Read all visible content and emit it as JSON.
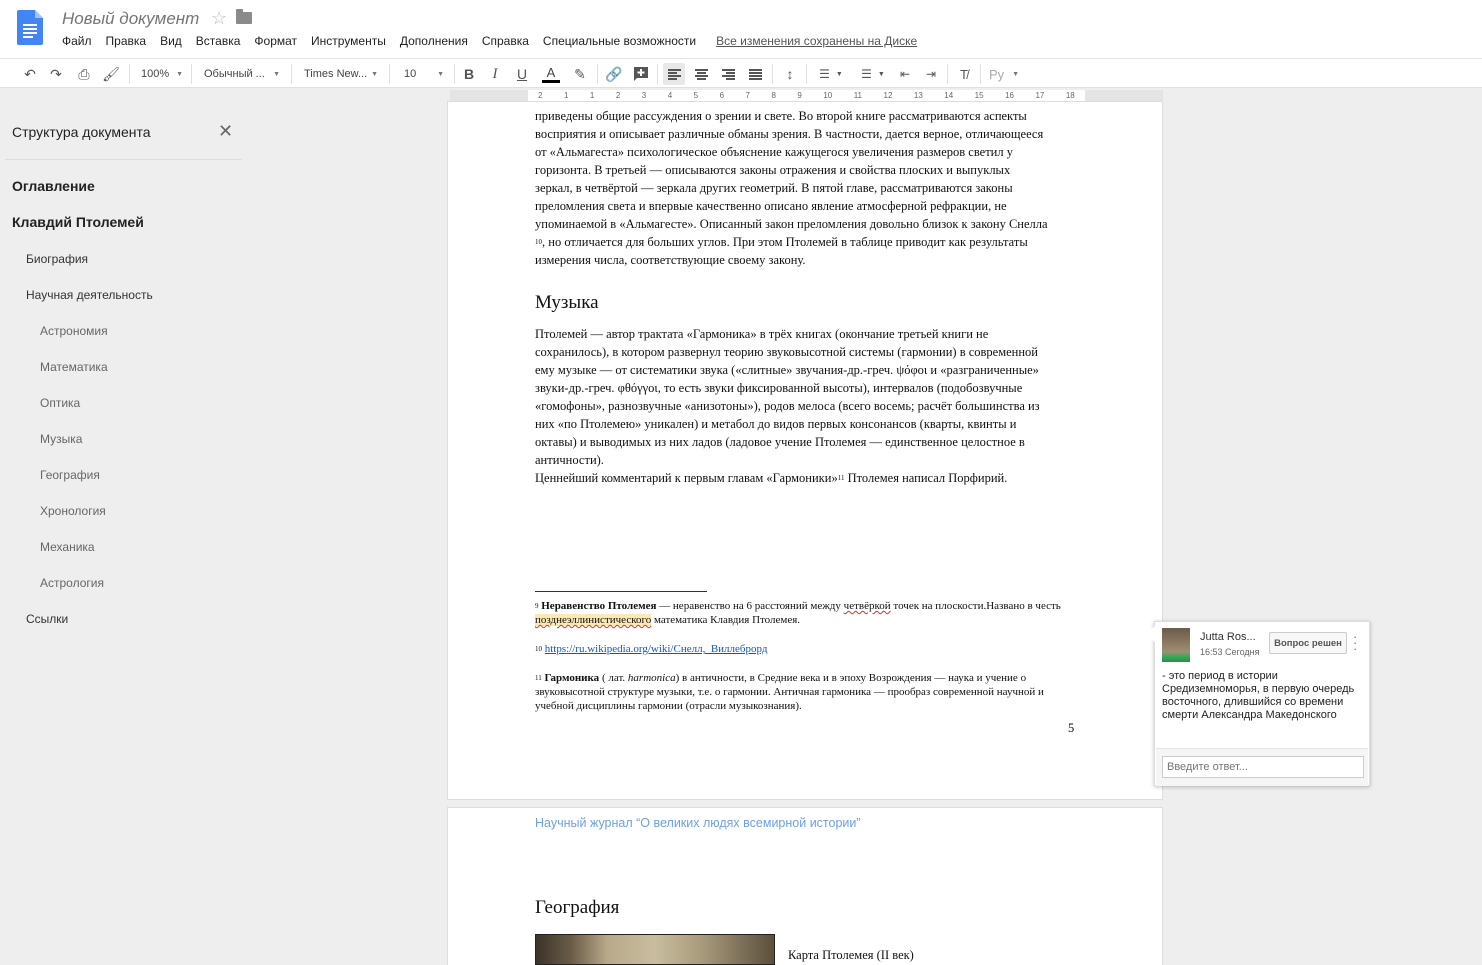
{
  "header": {
    "title": "Новый документ",
    "menu": [
      "Файл",
      "Правка",
      "Вид",
      "Вставка",
      "Формат",
      "Инструменты",
      "Дополнения",
      "Справка",
      "Специальные возможности"
    ],
    "saved_status": "Все изменения сохранены на Диске"
  },
  "toolbar": {
    "zoom": "100%",
    "style": "Обычный ...",
    "font": "Times New...",
    "size": "10",
    "text_color": "A",
    "input_tools": "Ру"
  },
  "ruler": {
    "ticks": [
      "2",
      "1",
      "1",
      "2",
      "3",
      "4",
      "5",
      "6",
      "7",
      "8",
      "9",
      "10",
      "11",
      "12",
      "13",
      "14",
      "15",
      "16",
      "17",
      "18"
    ]
  },
  "outline": {
    "title": "Структура документа",
    "items": [
      {
        "label": "Оглавление",
        "level": 1
      },
      {
        "label": "Клавдий Птолемей",
        "level": 1
      },
      {
        "label": "Биография",
        "level": 2
      },
      {
        "label": "Научная деятельность",
        "level": 2
      },
      {
        "label": "Астрономия",
        "level": 3
      },
      {
        "label": "Математика",
        "level": 3
      },
      {
        "label": "Оптика",
        "level": 3
      },
      {
        "label": "Музыка",
        "level": 3
      },
      {
        "label": "География",
        "level": 3
      },
      {
        "label": "Хронология",
        "level": 3
      },
      {
        "label": "Механика",
        "level": 3
      },
      {
        "label": "Астрология",
        "level": 3
      },
      {
        "label": "Ссылки",
        "level": 2
      }
    ]
  },
  "page1": {
    "top_paragraph_lines": [
      "приведены общие рассуждения о зрении и свете. Во второй книге рассматриваются аспекты",
      "восприятия и описывает различные обманы зрения. В частности, дается верное, отличающееся",
      "от «Альмагеста» психологическое объяснение кажущегося увеличения размеров светил у",
      "горизонта. В третьей — описываются законы отражения и свойства плоских и выпуклых",
      "зеркал, в четвёртой — зеркала других геометрий. В пятой главе, рассматриваются законы",
      "преломления света и впервые качественно описано явление атмосферной рефракции, не",
      "упоминаемой в «Альмагесте». Описанный закон преломления довольно близок к закону Снелла"
    ],
    "top_paragraph_sup": "10",
    "top_paragraph_tail": ", но отличается для больших углов. При этом Птолемей в таблице приводит как результаты",
    "top_paragraph_last": "измерения числа, соответствующие своему закону.",
    "music_heading": "Музыка",
    "music_lines": [
      "Птолемей — автор трактата «Гармоника» в трёх книгах (окончание третьей книги не",
      "сохранилось), в котором развернул теорию звуковысотной системы (гармонии) в современной",
      "ему музыке — от систематики звука («слитные» звучания-др.-греч. ψόφοι и «разграниченные»",
      "звуки-др.-греч. φθόγγοι, то есть звуки фиксированной высоты), интервалов (подобозвучные",
      "«гомофоны», разнозвучные «анизотоны»), родов мелоса (всего восемь; расчёт большинства из",
      "них «по Птолемею» уникален) и метабол до видов первых консонансов (кварты, квинты и",
      "октавы) и выводимых из них ладов (ладовое учение Птолемея — единственное целостное в",
      "античности)."
    ],
    "comment_line_a": "Ценнейший комментарий к первым главам «Гармоники»",
    "comment_line_sup": "11",
    "comment_line_b": " Птолемея написал Порфирий.",
    "fn9_num": "9",
    "fn9_bold": "Неравенство Птолемея",
    "fn9_text_a": " — неравенство на 6 расстояний между ",
    "fn9_err": "четвёркой",
    "fn9_text_b": " точек на плоскости.Названо в честь ",
    "fn9_hl": "позднеэллинистического",
    "fn9_text_c": " математика Клавдия Птолемея.",
    "fn10_num": "10",
    "fn10_link": "https://ru.wikipedia.org/wiki/Снелл,_Виллеброрд",
    "fn11_num": "11",
    "fn11_bold": "Гармоника",
    "fn11_text_a": " ( лат. ",
    "fn11_italic": "harmonica",
    "fn11_text_b": ") в античности, в Средние века и в эпоху Возрождения — наука и учение о звуковысотной структуре музыки, т.е. о гармонии. Античная гармоника — прообраз современной научной и учебной дисциплины гармонии (отрасли музыкознания).",
    "page_number": "5"
  },
  "page2": {
    "journal_header": "Научный журнал “О великих людях всемирной истории”",
    "geo_heading": "География",
    "map_caption": "Карта Птолемея (II век)"
  },
  "comment": {
    "author": "Jutta Ros...",
    "time": "16:53 Сегодня",
    "resolve_label": "Вопрос решен",
    "text": "- это период в истории Средиземноморья, в первую очередь восточного, длившийся со времени смерти Александра Македонского",
    "reply_placeholder": "Введите ответ..."
  },
  "colors": {
    "docs_blue": "#4285f4",
    "link": "#1155cc",
    "journal": "#6d9eeb",
    "highlight": "#fce8b2"
  }
}
